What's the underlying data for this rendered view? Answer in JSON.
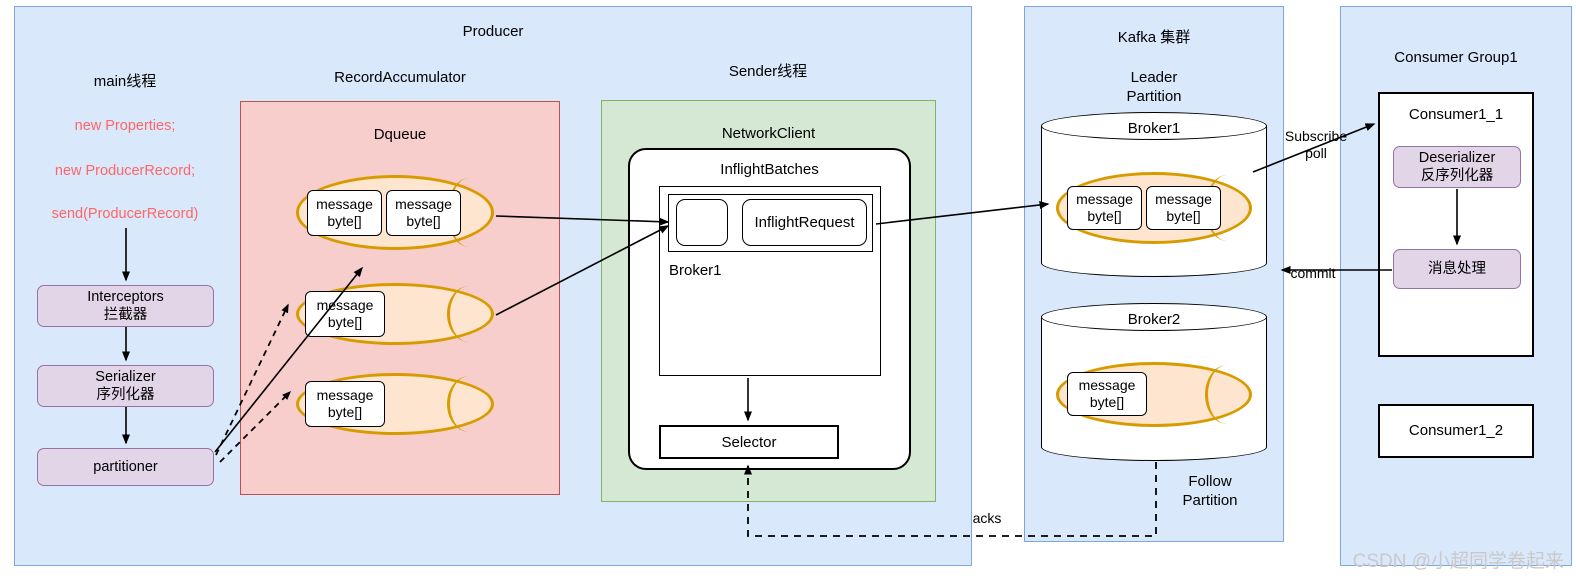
{
  "producer": {
    "title": "Producer",
    "main_thread": {
      "title": "main线程",
      "code_lines": [
        "new Properties;",
        "new ProducerRecord;",
        "send(ProducerRecord)"
      ],
      "stages": [
        {
          "label": "Interceptors\n拦截器"
        },
        {
          "label": "Serializer\n序列化器"
        },
        {
          "label": "partitioner"
        }
      ]
    },
    "record_accumulator": {
      "title": "RecordAccumulator",
      "dqueue_title": "Dqueue",
      "queues": [
        {
          "messages": [
            "message\nbyte[]",
            "message\nbyte[]"
          ]
        },
        {
          "messages": [
            "message\nbyte[]"
          ]
        },
        {
          "messages": [
            "message\nbyte[]"
          ]
        }
      ]
    },
    "sender_thread": {
      "title": "Sender线程",
      "network_client": "NetworkClient",
      "inflight_batches": "InflightBatches",
      "inflight_request": "InflightRequest",
      "broker_label": "Broker1",
      "selector": "Selector"
    }
  },
  "kafka_cluster": {
    "title": "Kafka 集群",
    "leader_partition": "Leader\nPartition",
    "follow_partition": "Follow\nPartition",
    "brokers": [
      {
        "name": "Broker1",
        "messages": [
          "message\nbyte[]",
          "message\nbyte[]"
        ]
      },
      {
        "name": "Broker2",
        "messages": [
          "message\nbyte[]"
        ]
      }
    ]
  },
  "consumer_group": {
    "title": "Consumer Group1",
    "consumers": [
      {
        "name": "Consumer1_1",
        "steps": [
          {
            "label": "Deserializer\n反序列化器"
          },
          {
            "label": "消息处理"
          }
        ]
      },
      {
        "name": "Consumer1_2",
        "steps": []
      }
    ]
  },
  "edges": {
    "acks": "acks",
    "subscribe_poll": "Subscribe\npoll",
    "commit": "commit"
  },
  "watermark": "CSDN @小超同学卷起来",
  "colors": {
    "panel_blue_fill": "#dae8fc",
    "panel_blue_stroke": "#7ea6e0",
    "panel_pink_fill": "#f8cecc",
    "panel_pink_stroke": "#b85450",
    "panel_green_fill": "#d5e8d4",
    "panel_green_stroke": "#82b366",
    "purple_fill": "#e1d5e7",
    "purple_stroke": "#9673a6",
    "queue_fill": "#fde5cf",
    "queue_stroke": "#d79b00",
    "code_text": "#ff6666"
  }
}
